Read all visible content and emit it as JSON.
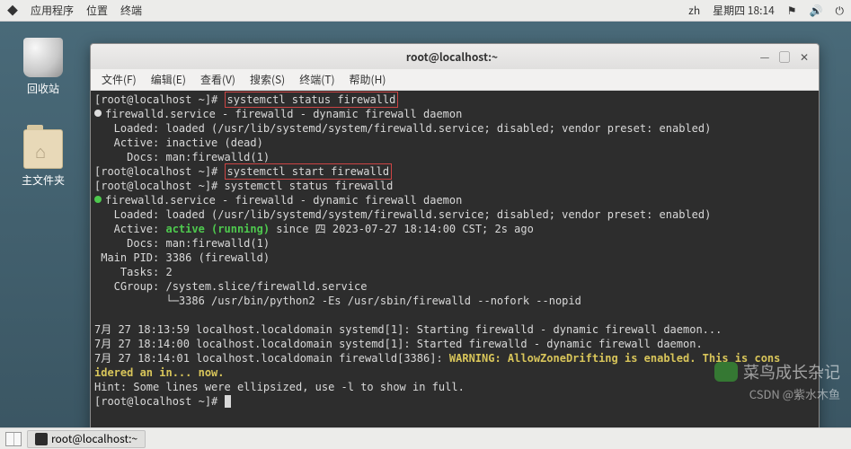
{
  "top_panel": {
    "apps": "应用程序",
    "places": "位置",
    "terminal": "终端",
    "lang": "zh",
    "date": "星期四 18:14"
  },
  "desktop": {
    "trash": "回收站",
    "home": "主文件夹"
  },
  "window": {
    "title": "root@localhost:~",
    "menu": {
      "file": "文件(F)",
      "edit": "编辑(E)",
      "view": "查看(V)",
      "search": "搜索(S)",
      "terminal": "终端(T)",
      "help": "帮助(H)"
    }
  },
  "term": {
    "prompt": "[root@localhost ~]#",
    "cmd_status": "systemctl status firewalld",
    "cmd_start": "systemctl start firewalld",
    "svc_line": "firewalld.service - firewalld - dynamic firewall daemon",
    "loaded": "   Loaded: loaded (/usr/lib/systemd/system/firewalld.service; disabled; vendor preset: enabled)",
    "inactive": "   Active: inactive (dead)",
    "active_pre": "   Active: ",
    "active_val": "active (running)",
    "active_post": " since 四 2023-07-27 18:14:00 CST; 2s ago",
    "docs": "     Docs: man:firewalld(1)",
    "pid": " Main PID: 3386 (firewalld)",
    "tasks": "    Tasks: 2",
    "cgroup1": "   CGroup: /system.slice/firewalld.service",
    "cgroup2": "           └─3386 /usr/bin/python2 -Es /usr/sbin/firewalld --nofork --nopid",
    "log1": "7月 27 18:13:59 localhost.localdomain systemd[1]: Starting firewalld - dynamic firewall daemon...",
    "log2": "7月 27 18:14:00 localhost.localdomain systemd[1]: Started firewalld - dynamic firewall daemon.",
    "log3a": "7月 27 18:14:01 localhost.localdomain firewalld[3386]: ",
    "log3b": "WARNING: AllowZoneDrifting is enabled. This is cons",
    "log3c": "idered an in... now.",
    "hint": "Hint: Some lines were ellipsized, use -l to show in full."
  },
  "taskbar": {
    "task": "root@localhost:~"
  },
  "watermark": {
    "l1": "菜鸟成长杂记",
    "l2": "CSDN @紫水木鱼"
  }
}
